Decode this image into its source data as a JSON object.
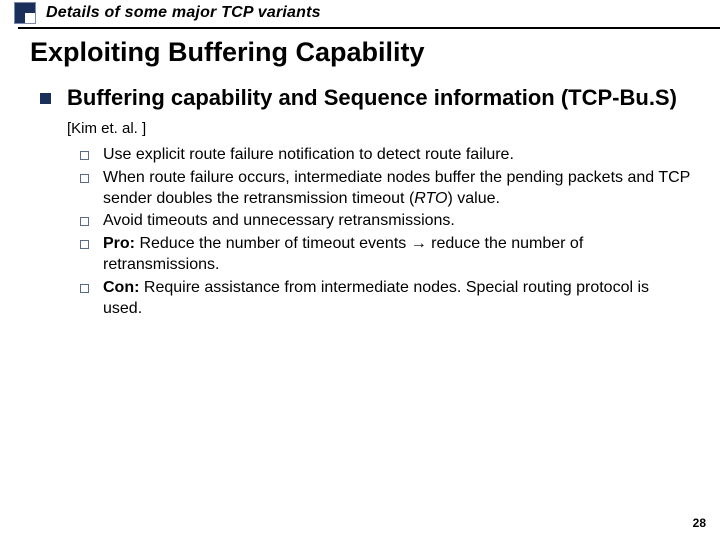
{
  "header": {
    "section_label": "Details of some major TCP variants"
  },
  "title": "Exploiting Buffering Capability",
  "main": {
    "heading": "Buffering capability and Sequence information (TCP-Bu.S)",
    "citation": "[Kim et. al. ]"
  },
  "items": {
    "a": "Use explicit route failure notification to detect route failure.",
    "b_pre": "When route failure occurs, intermediate nodes buffer the pending packets and TCP sender doubles the retransmission timeout (",
    "b_rto": "RTO",
    "b_post": ") value.",
    "c": "Avoid timeouts and unnecessary retransmissions.",
    "d_label": "Pro:",
    "d_pre": " Reduce the number of timeout events ",
    "d_arrow": "→",
    "d_post": " reduce the number of retransmissions.",
    "e_label": "Con:",
    "e_text": " Require assistance from intermediate nodes. Special routing protocol is used."
  },
  "page_number": "28"
}
